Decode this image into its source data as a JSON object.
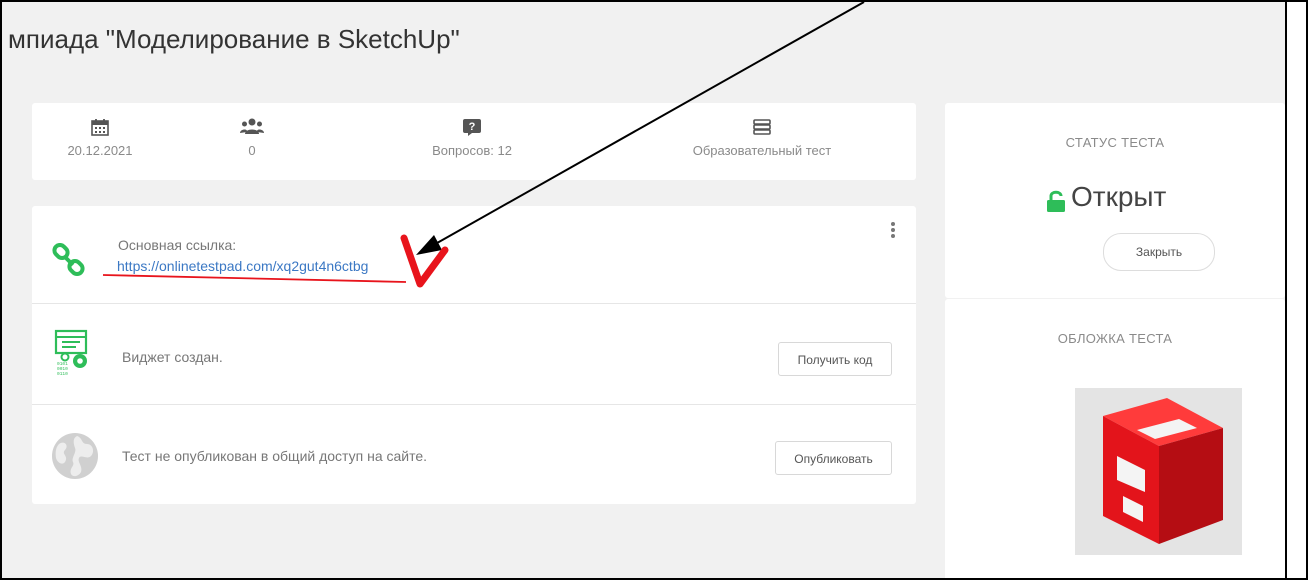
{
  "title": "мпиада \"Моделирование в SketchUp\"",
  "stats": {
    "date": "20.12.2021",
    "participants": "0",
    "questions": "Вопросов: 12",
    "type": "Образовательный тест"
  },
  "links": {
    "main_label": "Основная ссылка:",
    "main_url": "https://onlinetestpad.com/xq2gut4n6ctbg",
    "widget_text": "Виджет создан.",
    "widget_button": "Получить код",
    "publish_text": "Тест не опубликован в общий доступ на сайте.",
    "publish_button": "Опубликовать"
  },
  "status": {
    "title": "СТАТУС ТЕСТА",
    "value": "Открыт",
    "button": "Закрыть"
  },
  "cover": {
    "title": "ОБЛОЖКА ТЕСТА"
  },
  "icons": {
    "date": "calendar-icon",
    "participants": "users-icon",
    "questions": "question-icon",
    "type": "books-icon",
    "link": "link-icon",
    "widget": "widget-code-icon",
    "publish": "globe-icon",
    "status": "unlock-icon",
    "menu": "kebab-menu-icon"
  },
  "colors": {
    "accent_green": "#2ebd59",
    "link_blue": "#3b78c4",
    "annotation_red": "#e8141c",
    "sketchup_red": "#e3141b"
  }
}
